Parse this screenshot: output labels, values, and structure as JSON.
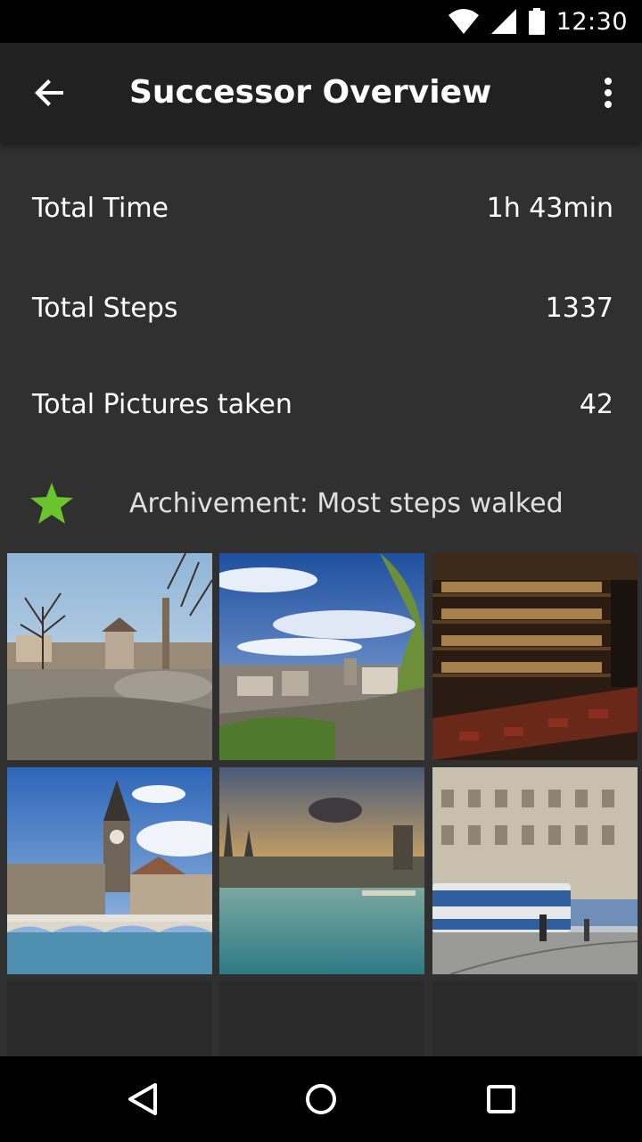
{
  "status_bar": {
    "time": "12:30",
    "icons": [
      "wifi-icon",
      "signal-icon",
      "battery-icon"
    ]
  },
  "app_bar": {
    "title": "Successor Overview",
    "back_icon": "arrow-back-icon",
    "overflow_icon": "more-vert-icon"
  },
  "stats": [
    {
      "label": "Total Time",
      "value": "1h 43min"
    },
    {
      "label": "Total Steps",
      "value": "1337"
    },
    {
      "label": "Total Pictures taken",
      "value": "42"
    }
  ],
  "achievement": {
    "icon": "star-icon",
    "icon_color": "#6ac42e",
    "label": "Archivement: Most steps walked"
  },
  "photos": [
    {
      "subject": "park with fountain and bare trees"
    },
    {
      "subject": "city view with blue sky"
    },
    {
      "subject": "bar with bottle shelves"
    },
    {
      "subject": "church tower by the river with bridge"
    },
    {
      "subject": "river at sunset with towers"
    },
    {
      "subject": "tram in front of building"
    },
    {
      "subject": "empty"
    },
    {
      "subject": "empty"
    },
    {
      "subject": "empty"
    }
  ],
  "nav_bar": {
    "back_icon": "nav-back-icon",
    "home_icon": "nav-home-icon",
    "recents_icon": "nav-recents-icon"
  },
  "colors": {
    "background": "#303030",
    "app_bar": "#212121",
    "accent_star": "#6ac42e"
  }
}
